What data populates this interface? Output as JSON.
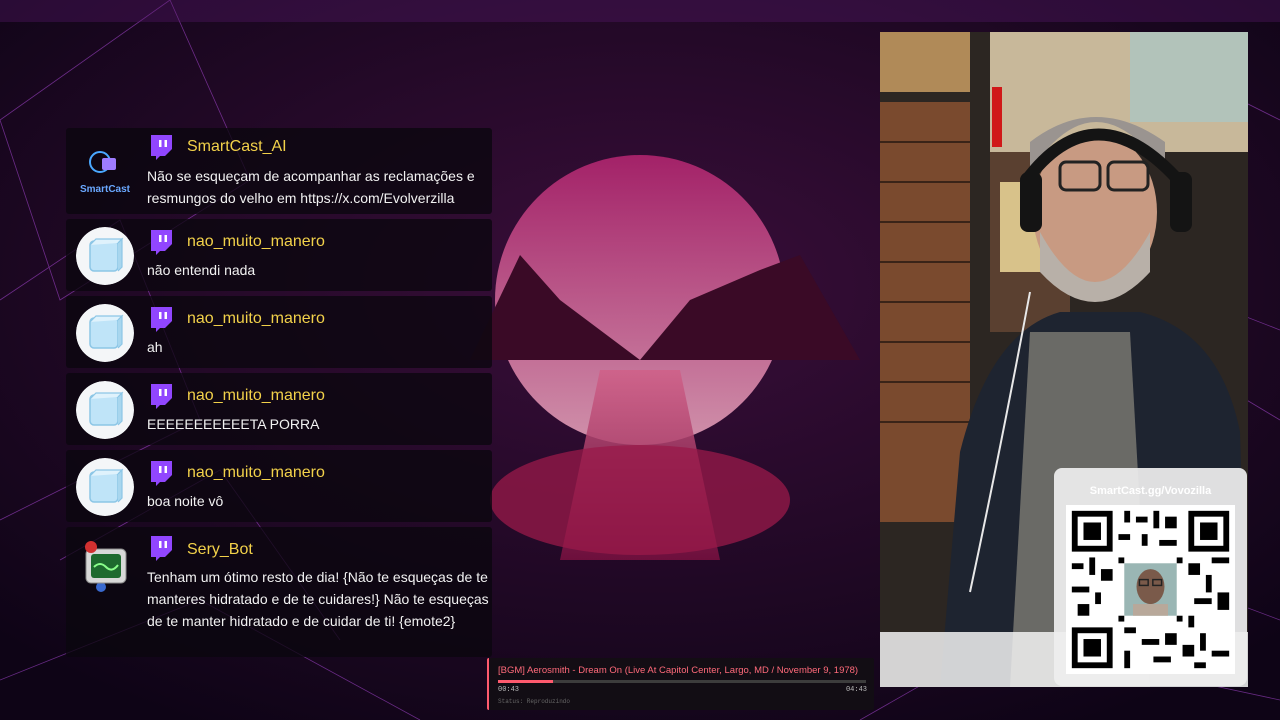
{
  "chat": {
    "messages": [
      {
        "user": "SmartCast_AI",
        "text": "Não se esqueçam de acompanhar as reclamações e resmungos do velho em https://x.com/Evolverzilla",
        "avatar_label": "SmartCast"
      },
      {
        "user": "nao_muito_manero",
        "text": "não entendi nada"
      },
      {
        "user": "nao_muito_manero",
        "text": "ah"
      },
      {
        "user": "nao_muito_manero",
        "text": "EEEEEEEEEEETA PORRA"
      },
      {
        "user": "nao_muito_manero",
        "text": "boa noite vô"
      },
      {
        "user": "Sery_Bot",
        "text": "Tenham um ótimo resto de dia! {Não te esqueças de te manteres hidratado e de te cuidares!} Não te esqueças de te manter hidratado e de cuidar de ti! {emote2}"
      }
    ],
    "platform_icon": "twitch-icon"
  },
  "qr": {
    "url": "SmartCast.gg/Vovozilla"
  },
  "player": {
    "track": "[BGM] Aerosmith - Dream On (Live At Capitol Center, Largo, MD / November 9, 1978)",
    "current_time": "00:43",
    "duration": "04:43",
    "status": "Status: Reproduzindo",
    "progress": 0.15
  },
  "colors": {
    "username": "#f2d14a",
    "twitch": "#9146ff",
    "accent": "#ff5a6e"
  }
}
